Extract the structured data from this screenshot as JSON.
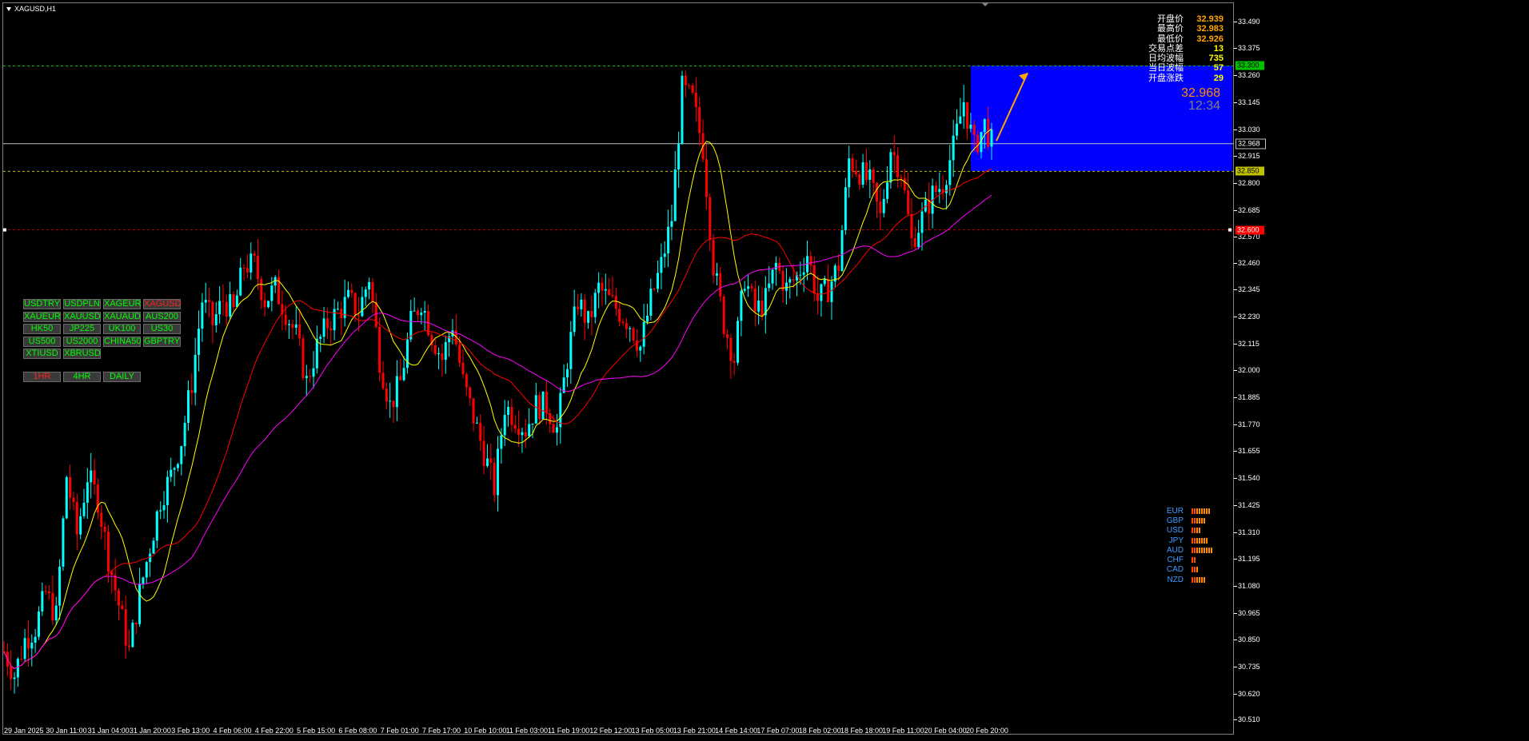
{
  "window_title": "XAGUSD,H1",
  "info_panel": [
    {
      "label": "开盘价",
      "value": "32.939",
      "color": "#ffa500"
    },
    {
      "label": "最高价",
      "value": "32.983",
      "color": "#ffa500"
    },
    {
      "label": "最低价",
      "value": "32.926",
      "color": "#ffa500"
    },
    {
      "label": "交易点差",
      "value": "13",
      "color": "#ffff00"
    },
    {
      "label": "日均波幅",
      "value": "735",
      "color": "#ffff00"
    },
    {
      "label": "当日波幅",
      "value": "57",
      "color": "#ffff00"
    },
    {
      "label": "开盘涨跌",
      "value": "29",
      "color": "#ffff00"
    }
  ],
  "current_price": "32.968",
  "candle_timer": "12:34",
  "symbol_buttons": [
    {
      "label": "USDTRY",
      "active": false
    },
    {
      "label": "USDPLN",
      "active": false
    },
    {
      "label": "XAGEUR",
      "active": false
    },
    {
      "label": "XAGUSD",
      "active": true
    },
    {
      "label": "XAUEUR",
      "active": false
    },
    {
      "label": "XAUUSD",
      "active": false
    },
    {
      "label": "XAUAUD",
      "active": false
    },
    {
      "label": "AUS200",
      "active": false
    },
    {
      "label": "HK50",
      "active": false
    },
    {
      "label": "JP225",
      "active": false
    },
    {
      "label": "UK100",
      "active": false
    },
    {
      "label": "US30",
      "active": false
    },
    {
      "label": "US500",
      "active": false
    },
    {
      "label": "US2000",
      "active": false
    },
    {
      "label": "CHINA50",
      "active": false
    },
    {
      "label": "GBPTRY",
      "active": false
    },
    {
      "label": "XTIUSD",
      "active": false
    },
    {
      "label": "XBRUSD",
      "active": false
    }
  ],
  "timeframe_buttons": [
    {
      "label": "1HR",
      "active": true
    },
    {
      "label": "4HR",
      "active": false
    },
    {
      "label": "DAILY",
      "active": false
    }
  ],
  "currency_strength": [
    {
      "name": "EUR",
      "level": 8
    },
    {
      "name": "GBP",
      "level": 6
    },
    {
      "name": "USD",
      "level": 4
    },
    {
      "name": "JPY",
      "level": 7
    },
    {
      "name": "AUD",
      "level": 9
    },
    {
      "name": "CHF",
      "level": 2
    },
    {
      "name": "CAD",
      "level": 3
    },
    {
      "name": "NZD",
      "level": 6
    }
  ],
  "price_tags": {
    "resistance": "33.300",
    "current": "32.968",
    "support": "32.850",
    "red_line": "32.600"
  },
  "colors": {
    "bull_candle": "#00ffff",
    "bear_candle": "#ff0000",
    "ma_fast": "#ffff00",
    "ma_mid": "#ff0000",
    "ma_slow": "#ff00ff",
    "zone": "#0000ff",
    "arrow": "#ffa500"
  },
  "chart_data": {
    "type": "candlestick",
    "symbol": "XAGUSD",
    "timeframe": "H1",
    "y_ticks": [
      "33.490",
      "33.375",
      "33.260",
      "33.145",
      "33.030",
      "32.915",
      "32.800",
      "32.685",
      "32.570",
      "32.460",
      "32.345",
      "32.230",
      "32.115",
      "32.000",
      "31.885",
      "31.770",
      "31.655",
      "31.540",
      "31.425",
      "31.310",
      "31.195",
      "31.080",
      "30.965",
      "30.850",
      "30.735",
      "30.620",
      "30.510"
    ],
    "ylim": [
      30.51,
      33.52
    ],
    "x_ticks": [
      "29 Jan 2025",
      "30 Jan 11:00",
      "31 Jan 04:00",
      "31 Jan 20:00",
      "3 Feb 13:00",
      "4 Feb 06:00",
      "4 Feb 22:00",
      "5 Feb 15:00",
      "6 Feb 08:00",
      "7 Feb 01:00",
      "7 Feb 17:00",
      "10 Feb 10:00",
      "11 Feb 03:00",
      "11 Feb 19:00",
      "12 Feb 12:00",
      "13 Feb 05:00",
      "13 Feb 21:00",
      "14 Feb 14:00",
      "17 Feb 07:00",
      "18 Feb 02:00",
      "18 Feb 18:00",
      "19 Feb 11:00",
      "20 Feb 04:00",
      "20 Feb 20:00"
    ],
    "horizontal_levels": [
      {
        "value": 33.3,
        "style": "dashed",
        "color": "#00c000"
      },
      {
        "value": 32.968,
        "style": "solid",
        "color": "#c0c0c0"
      },
      {
        "value": 32.85,
        "style": "dashed",
        "color": "#c0c000"
      },
      {
        "value": 32.6,
        "style": "dashed",
        "color": "#c00000"
      }
    ],
    "price_path": [
      [
        0,
        30.8
      ],
      [
        3,
        30.7
      ],
      [
        6,
        30.85
      ],
      [
        9,
        30.9
      ],
      [
        12,
        31.05
      ],
      [
        15,
        30.95
      ],
      [
        18,
        31.55
      ],
      [
        21,
        31.3
      ],
      [
        24,
        31.55
      ],
      [
        27,
        31.45
      ],
      [
        30,
        31.2
      ],
      [
        33,
        31.0
      ],
      [
        36,
        30.8
      ],
      [
        39,
        31.05
      ],
      [
        42,
        31.25
      ],
      [
        45,
        31.45
      ],
      [
        48,
        31.55
      ],
      [
        51,
        31.7
      ],
      [
        54,
        31.95
      ],
      [
        57,
        32.3
      ],
      [
        60,
        32.2
      ],
      [
        63,
        32.3
      ],
      [
        66,
        32.25
      ],
      [
        69,
        32.45
      ],
      [
        72,
        32.45
      ],
      [
        75,
        32.3
      ],
      [
        78,
        32.35
      ],
      [
        81,
        32.25
      ],
      [
        84,
        32.15
      ],
      [
        87,
        31.95
      ],
      [
        90,
        32.1
      ],
      [
        93,
        32.2
      ],
      [
        96,
        32.25
      ],
      [
        99,
        32.3
      ],
      [
        102,
        32.25
      ],
      [
        105,
        32.4
      ],
      [
        108,
        32.05
      ],
      [
        111,
        31.85
      ],
      [
        114,
        31.95
      ],
      [
        117,
        32.2
      ],
      [
        120,
        32.3
      ],
      [
        123,
        32.15
      ],
      [
        126,
        32.05
      ],
      [
        129,
        32.2
      ],
      [
        132,
        31.95
      ],
      [
        135,
        31.8
      ],
      [
        138,
        31.65
      ],
      [
        141,
        31.5
      ],
      [
        144,
        31.85
      ],
      [
        147,
        31.8
      ],
      [
        150,
        31.75
      ],
      [
        153,
        31.85
      ],
      [
        156,
        31.85
      ],
      [
        159,
        31.75
      ],
      [
        162,
        32.05
      ],
      [
        165,
        32.3
      ],
      [
        168,
        32.2
      ],
      [
        171,
        32.35
      ],
      [
        174,
        32.3
      ],
      [
        177,
        32.25
      ],
      [
        180,
        32.2
      ],
      [
        183,
        32.1
      ],
      [
        186,
        32.3
      ],
      [
        189,
        32.45
      ],
      [
        192,
        32.65
      ],
      [
        195,
        33.2
      ],
      [
        198,
        33.15
      ],
      [
        201,
        32.95
      ],
      [
        204,
        32.45
      ],
      [
        207,
        32.2
      ],
      [
        210,
        32.05
      ],
      [
        213,
        32.4
      ],
      [
        216,
        32.25
      ],
      [
        219,
        32.3
      ],
      [
        222,
        32.45
      ],
      [
        225,
        32.35
      ],
      [
        228,
        32.4
      ],
      [
        231,
        32.5
      ],
      [
        234,
        32.3
      ],
      [
        237,
        32.35
      ],
      [
        240,
        32.45
      ],
      [
        243,
        32.9
      ],
      [
        246,
        32.85
      ],
      [
        249,
        32.8
      ],
      [
        252,
        32.65
      ],
      [
        255,
        32.95
      ],
      [
        258,
        32.85
      ],
      [
        261,
        32.55
      ],
      [
        264,
        32.65
      ],
      [
        267,
        32.75
      ],
      [
        270,
        32.8
      ],
      [
        273,
        32.95
      ],
      [
        276,
        33.15
      ],
      [
        279,
        32.95
      ],
      [
        282,
        33.05
      ],
      [
        284,
        32.97
      ]
    ],
    "total_bars": 285,
    "projection_zone": {
      "top": 33.3,
      "bottom": 32.85
    }
  }
}
